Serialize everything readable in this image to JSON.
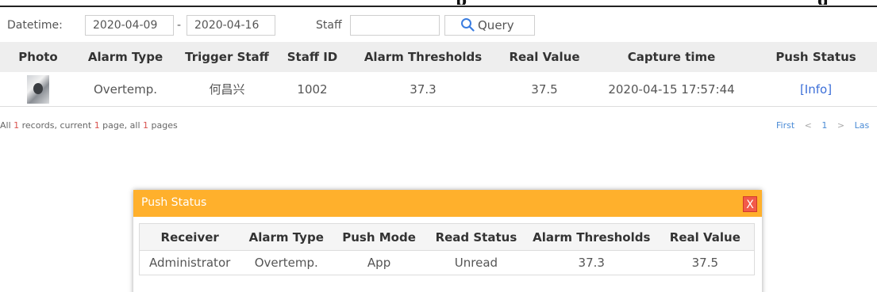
{
  "caption": {
    "left_fragment": "p",
    "right_fragment": "g"
  },
  "filter": {
    "datetime_label": "Datetime:",
    "date_from": "2020-04-09",
    "separator": "-",
    "date_to": "2020-04-16",
    "staff_label": "Staff",
    "staff_value": "",
    "query_label": "Query",
    "query_icon": "search-icon"
  },
  "table": {
    "headers": [
      "Photo",
      "Alarm Type",
      "Trigger Staff",
      "Staff ID",
      "Alarm Thresholds",
      "Real Value",
      "Capture time",
      "Push Status"
    ],
    "rows": [
      {
        "photo": "photo-thumbnail",
        "alarm_type": "Overtemp.",
        "trigger_staff": "何昌兴",
        "staff_id": "1002",
        "alarm_thresholds": "37.3",
        "real_value": "37.5",
        "capture_time": "2020-04-15 17:57:44",
        "push_status": "[Info]"
      }
    ]
  },
  "pagination": {
    "all": "All ",
    "record_count": "1",
    "records_text": " records, current ",
    "current_page": "1",
    "page_text": " page, all ",
    "total_pages": "1",
    "pages_text": " pages",
    "first": "First",
    "prev": "<",
    "page": "1",
    "next": ">",
    "last": "Las"
  },
  "dialog": {
    "title": "Push Status",
    "close_label": "X",
    "headers": [
      "Receiver",
      "Alarm Type",
      "Push Mode",
      "Read Status",
      "Alarm Thresholds",
      "Real Value"
    ],
    "rows": [
      {
        "receiver": "Administrator",
        "alarm_type": "Overtemp.",
        "push_mode": "App",
        "read_status": "Unread",
        "alarm_thresholds": "37.3",
        "real_value": "37.5"
      }
    ]
  },
  "colors": {
    "dialog_header": "#ffb02c",
    "close_button": "#f25a4a",
    "link": "#3c6fd8",
    "highlight": "#d9534f",
    "table_header_bg": "#eeeeee"
  }
}
